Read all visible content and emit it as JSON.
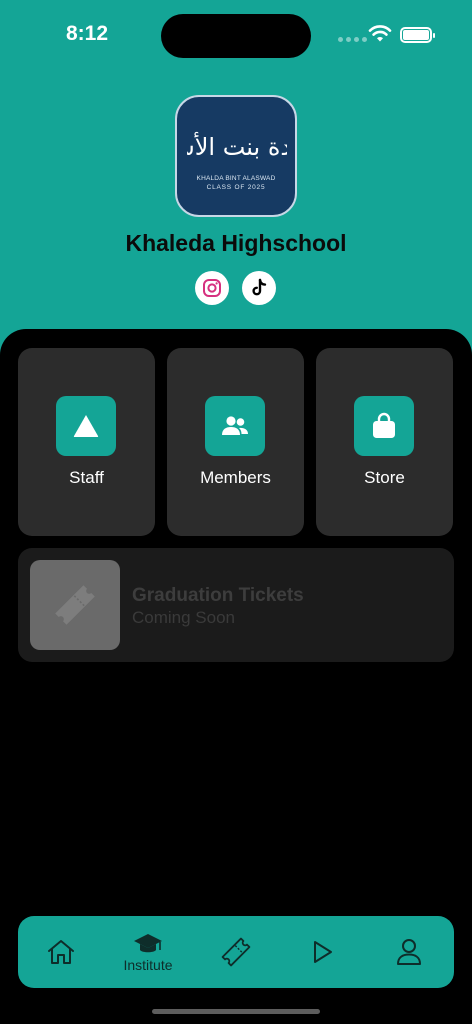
{
  "status_bar": {
    "time": "8:12"
  },
  "header": {
    "logo": {
      "arabic_text": "خالدة بنت الأسود",
      "line1": "KHALDA BINT ALASWAD",
      "line2": "CLASS OF 2025"
    },
    "school_name": "Khaleda Highschool",
    "social_links": [
      "instagram-icon",
      "tiktok-icon"
    ]
  },
  "tiles": [
    {
      "label": "Staff",
      "icon": "triangle-icon"
    },
    {
      "label": "Members",
      "icon": "people-icon"
    },
    {
      "label": "Store",
      "icon": "shopping-bag-icon"
    }
  ],
  "tickets_card": {
    "title": "Graduation Tickets",
    "subtitle": "Coming Soon",
    "icon": "ticket-icon"
  },
  "tab_bar": {
    "items": [
      {
        "icon": "home-icon",
        "label": ""
      },
      {
        "icon": "graduation-cap-icon",
        "label": "Institute"
      },
      {
        "icon": "ticket-icon",
        "label": ""
      },
      {
        "icon": "play-icon",
        "label": ""
      },
      {
        "icon": "profile-icon",
        "label": ""
      }
    ],
    "active": "Institute"
  },
  "colors": {
    "accent": "#14a596",
    "background": "#000000",
    "tile": "#2c2c2c",
    "logo_background": "#163a63"
  }
}
